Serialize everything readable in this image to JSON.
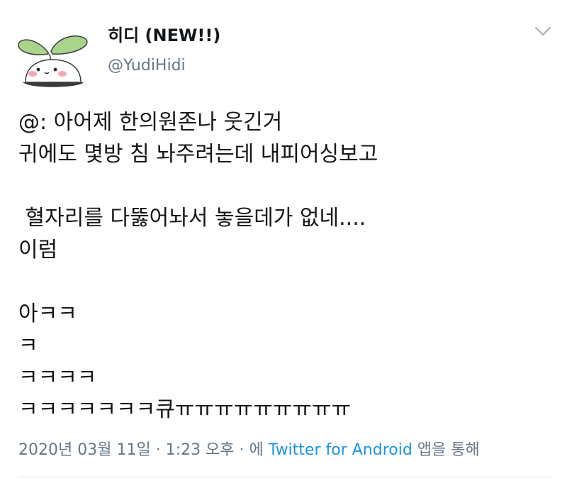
{
  "tweet": {
    "display_name": "히디 (NEW!!)",
    "handle": "@YudiHidi",
    "lines": [
      "@: 아어제 한의원존나 웃긴거",
      "귀에도 몇방 침 놔주려는데 내피어싱보고",
      "",
      " 혈자리를 다뚫어놔서 놓을데가 없네....",
      "이럼",
      "",
      "아ㅋㅋ",
      "ㅋ",
      "ㅋㅋㅋㅋ",
      "ㅋㅋㅋㅋㅋㅋㅋ큐ㅠㅠㅠㅠㅠㅠㅠㅠㅠ"
    ],
    "timestamp": "2020년 03월 11일 · 1:23 오후 · 에",
    "via": "Twitter for Android",
    "via_suffix": "앱을 통해"
  },
  "icons": {
    "avatar": "sprout-character-avatar",
    "menu": "chevron-down-icon"
  },
  "colors": {
    "text": "#14171a",
    "secondary": "#657786",
    "link": "#1b95e0",
    "divider": "#e1e8ed"
  }
}
